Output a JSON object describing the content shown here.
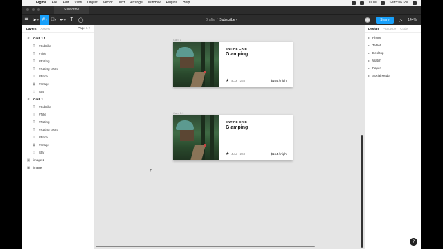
{
  "menubar": {
    "app": "Figma",
    "items": [
      "File",
      "Edit",
      "View",
      "Object",
      "Vector",
      "Text",
      "Arrange",
      "Window",
      "Plugins",
      "Help"
    ],
    "clock": "Sat 5:06 PM",
    "battery": "100%"
  },
  "tab": {
    "name": "Subscribe"
  },
  "toolbar": {
    "crumb_folder": "Drafts",
    "crumb_sep": "/",
    "file_name": "Subscribe",
    "share_label": "Share",
    "zoom": "144%"
  },
  "left_panel": {
    "tab_layers": "Layers",
    "tab_assets": "Assets",
    "page": "Page 1",
    "layers": [
      {
        "label": "Card 1.1",
        "level": 0,
        "icon": "#"
      },
      {
        "label": "#Subtitle",
        "level": 1,
        "icon": "T"
      },
      {
        "label": "#Title",
        "level": 1,
        "icon": "T"
      },
      {
        "label": "#Rating",
        "level": 1,
        "icon": "T"
      },
      {
        "label": "#Rating count",
        "level": 1,
        "icon": "T"
      },
      {
        "label": "#Price",
        "level": 1,
        "icon": "T"
      },
      {
        "label": "#Image",
        "level": 1,
        "icon": "▣"
      },
      {
        "label": "Star",
        "level": 1,
        "icon": "☆"
      },
      {
        "label": "Card 1",
        "level": 0,
        "icon": "#"
      },
      {
        "label": "#Subtitle",
        "level": 1,
        "icon": "T"
      },
      {
        "label": "#Title",
        "level": 1,
        "icon": "T"
      },
      {
        "label": "#Rating",
        "level": 1,
        "icon": "T"
      },
      {
        "label": "#Rating count",
        "level": 1,
        "icon": "T"
      },
      {
        "label": "#Price",
        "level": 1,
        "icon": "T"
      },
      {
        "label": "#Image",
        "level": 1,
        "icon": "▣"
      },
      {
        "label": "Star",
        "level": 1,
        "icon": "☆"
      },
      {
        "label": "image 2",
        "level": 2,
        "icon": "▣"
      },
      {
        "label": "image",
        "level": 2,
        "icon": "▣"
      }
    ]
  },
  "right_panel": {
    "tab_design": "Design",
    "tab_prototype": "Prototype",
    "tab_code": "Code",
    "presets": [
      "Phone",
      "Tablet",
      "Desktop",
      "Watch",
      "Paper",
      "Social Media"
    ]
  },
  "canvas": {
    "cards": [
      {
        "frame_label": "Card 1",
        "subtitle": "ENTIRE CRIB",
        "title": "Glamping",
        "rating": "4.14",
        "rating_count": "·268",
        "price": "$164 / night"
      },
      {
        "frame_label": "Card 1.1",
        "subtitle": "ENTIRE CRIB",
        "title": "Glamping",
        "rating": "4.14",
        "rating_count": "·268",
        "price": "$164 / night"
      }
    ]
  },
  "help_label": "?",
  "colors": {
    "accent": "#18a0fb",
    "toolbar": "#2c2c2c",
    "canvas": "#e5e5e5"
  }
}
